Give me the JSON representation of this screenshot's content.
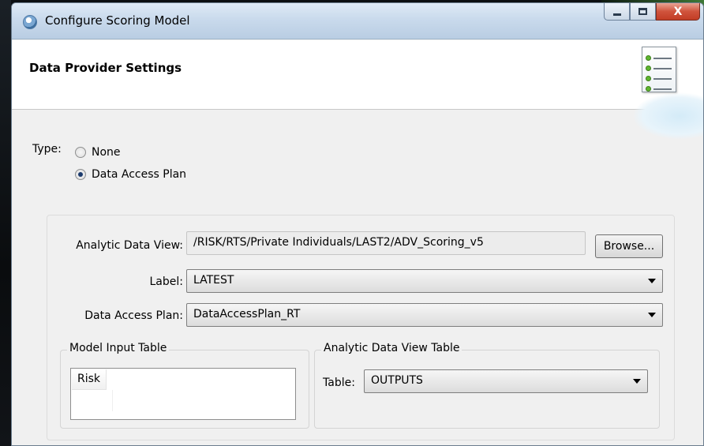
{
  "window": {
    "title": "Configure Scoring Model",
    "controls": {
      "close_label": "X"
    }
  },
  "header": {
    "title": "Data Provider Settings",
    "icon": "settings-list-icon"
  },
  "type_section": {
    "label": "Type:",
    "options": [
      {
        "label": "None",
        "checked": false
      },
      {
        "label": "Data Access Plan",
        "checked": true
      }
    ]
  },
  "fields": {
    "analytic_data_view": {
      "label": "Analytic Data View:",
      "value": "/RISK/RTS/Private Individuals/LAST2/ADV_Scoring_v5"
    },
    "browse_button": "Browse...",
    "label_field": {
      "label": "Label:",
      "value": "LATEST"
    },
    "data_access_plan": {
      "label": "Data Access Plan:",
      "value": "DataAccessPlan_RT"
    }
  },
  "model_input_table": {
    "legend": "Model Input Table",
    "column": "Risk"
  },
  "analytic_data_view_table": {
    "legend": "Analytic Data View Table",
    "table_label": "Table:",
    "table_value": "OUTPUTS"
  },
  "colors": {
    "title_bar": "#c9daec",
    "close_button": "#c94a33",
    "panel_bg": "#f0f0f0",
    "header_bg": "#ffffff"
  }
}
